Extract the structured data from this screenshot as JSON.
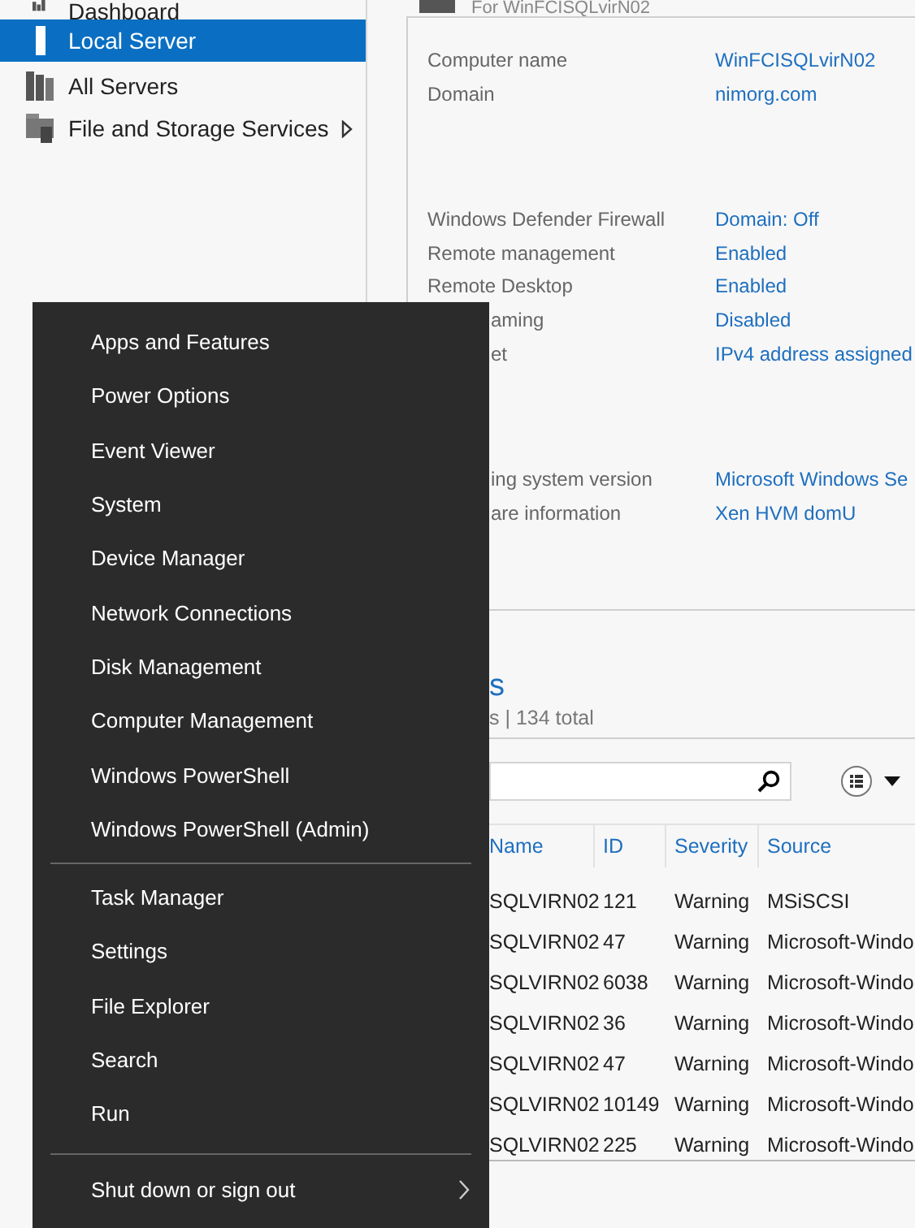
{
  "sidebar": {
    "items": [
      {
        "label": "Dashboard",
        "kind": "dashboard",
        "selected": false,
        "has_submenu": false
      },
      {
        "label": "Local Server",
        "kind": "server",
        "selected": true,
        "has_submenu": false
      },
      {
        "label": "All Servers",
        "kind": "servers",
        "selected": false,
        "has_submenu": false
      },
      {
        "label": "File and Storage Services",
        "kind": "storage",
        "selected": false,
        "has_submenu": true
      }
    ]
  },
  "properties": {
    "title": "For WinFCISQLvirN02",
    "groups": [
      {
        "rows": [
          {
            "label": "Computer name",
            "value": "WinFCISQLvirN02"
          },
          {
            "label": "Domain",
            "value": "nimorg.com"
          }
        ]
      },
      {
        "rows": [
          {
            "label": "Windows Defender Firewall",
            "value": "Domain: Off"
          },
          {
            "label": "Remote management",
            "value": "Enabled"
          },
          {
            "label": "Remote Desktop",
            "value": "Enabled"
          },
          {
            "label": "aming",
            "value": "Disabled"
          },
          {
            "label": "et",
            "value": "IPv4 address assigned"
          }
        ]
      },
      {
        "rows": [
          {
            "label": "ing system version",
            "value": "Microsoft Windows Se"
          },
          {
            "label": "are information",
            "value": "Xen HVM domU"
          }
        ]
      }
    ]
  },
  "events": {
    "heading": "s",
    "summary": "s | 134 total",
    "columns": [
      "Name",
      "ID",
      "Severity",
      "Source"
    ],
    "rows": [
      [
        "SQLVIRN02",
        "121",
        "Warning",
        "MSiSCSI"
      ],
      [
        "SQLVIRN02",
        "47",
        "Warning",
        "Microsoft-Windo"
      ],
      [
        "SQLVIRN02",
        "6038",
        "Warning",
        "Microsoft-Windo"
      ],
      [
        "SQLVIRN02",
        "36",
        "Warning",
        "Microsoft-Windo"
      ],
      [
        "SQLVIRN02",
        "47",
        "Warning",
        "Microsoft-Windo"
      ],
      [
        "SQLVIRN02",
        "10149",
        "Warning",
        "Microsoft-Windo"
      ],
      [
        "SQLVIRN02",
        "225",
        "Warning",
        "Microsoft-Windo"
      ]
    ]
  },
  "context_menu": {
    "groups": [
      {
        "items": [
          {
            "label": "Apps and Features",
            "has_submenu": false
          },
          {
            "label": "Power Options",
            "has_submenu": false
          },
          {
            "label": "Event Viewer",
            "has_submenu": false
          },
          {
            "label": "System",
            "has_submenu": false
          },
          {
            "label": "Device Manager",
            "has_submenu": false
          },
          {
            "label": "Network Connections",
            "has_submenu": false
          },
          {
            "label": "Disk Management",
            "has_submenu": false
          },
          {
            "label": "Computer Management",
            "has_submenu": false
          },
          {
            "label": "Windows PowerShell",
            "has_submenu": false
          },
          {
            "label": "Windows PowerShell (Admin)",
            "has_submenu": false
          }
        ]
      },
      {
        "items": [
          {
            "label": "Task Manager",
            "has_submenu": false
          },
          {
            "label": "Settings",
            "has_submenu": false
          },
          {
            "label": "File Explorer",
            "has_submenu": false
          },
          {
            "label": "Search",
            "has_submenu": false
          },
          {
            "label": "Run",
            "has_submenu": false
          }
        ]
      },
      {
        "items": [
          {
            "label": "Shut down or sign out",
            "has_submenu": true
          }
        ]
      }
    ]
  }
}
